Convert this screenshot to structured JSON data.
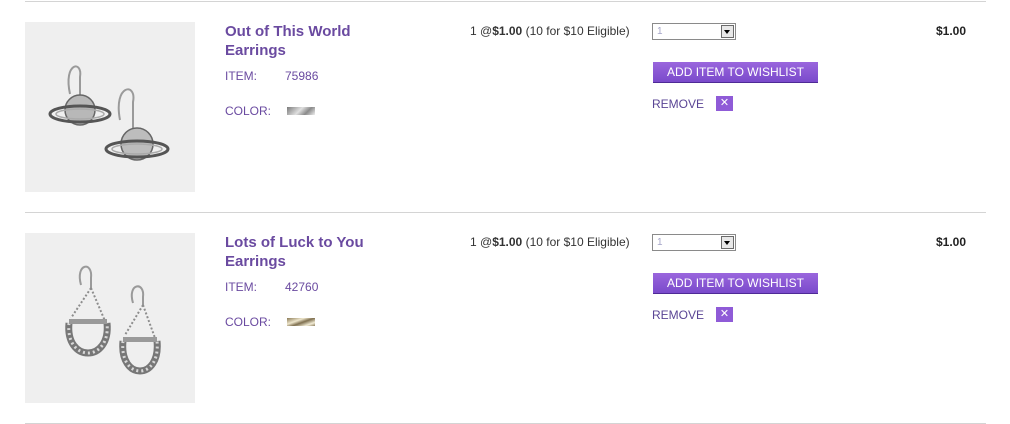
{
  "cart": {
    "items": [
      {
        "title": "Out of This World Earrings",
        "item_label": "ITEM:",
        "item_number": "75986",
        "color_label": "COLOR:",
        "qty_at": "1 @",
        "unit_price": "$1.00",
        "promo": "(10 for $10 Eligible)",
        "quantity": "1",
        "wishlist_label": "ADD ITEM TO WISHLIST",
        "remove_label": "REMOVE",
        "remove_icon": "close-icon",
        "total": "$1.00",
        "swatch_colors": [
          "#8c8c8c",
          "#d9d9d9"
        ],
        "image_icon": "saturn-earrings-image"
      },
      {
        "title": "Lots of Luck to You Earrings",
        "item_label": "ITEM:",
        "item_number": "42760",
        "color_label": "COLOR:",
        "qty_at": "1 @",
        "unit_price": "$1.00",
        "promo": "(10 for $10 Eligible)",
        "quantity": "1",
        "wishlist_label": "ADD ITEM TO WISHLIST",
        "remove_label": "REMOVE",
        "remove_icon": "close-icon",
        "total": "$1.00",
        "swatch_colors": [
          "#8a7a55",
          "#e8e0c8"
        ],
        "image_icon": "horseshoe-earrings-image"
      }
    ],
    "colors": {
      "accent": "#6a4aa0",
      "button": "#8f5bd7"
    }
  }
}
